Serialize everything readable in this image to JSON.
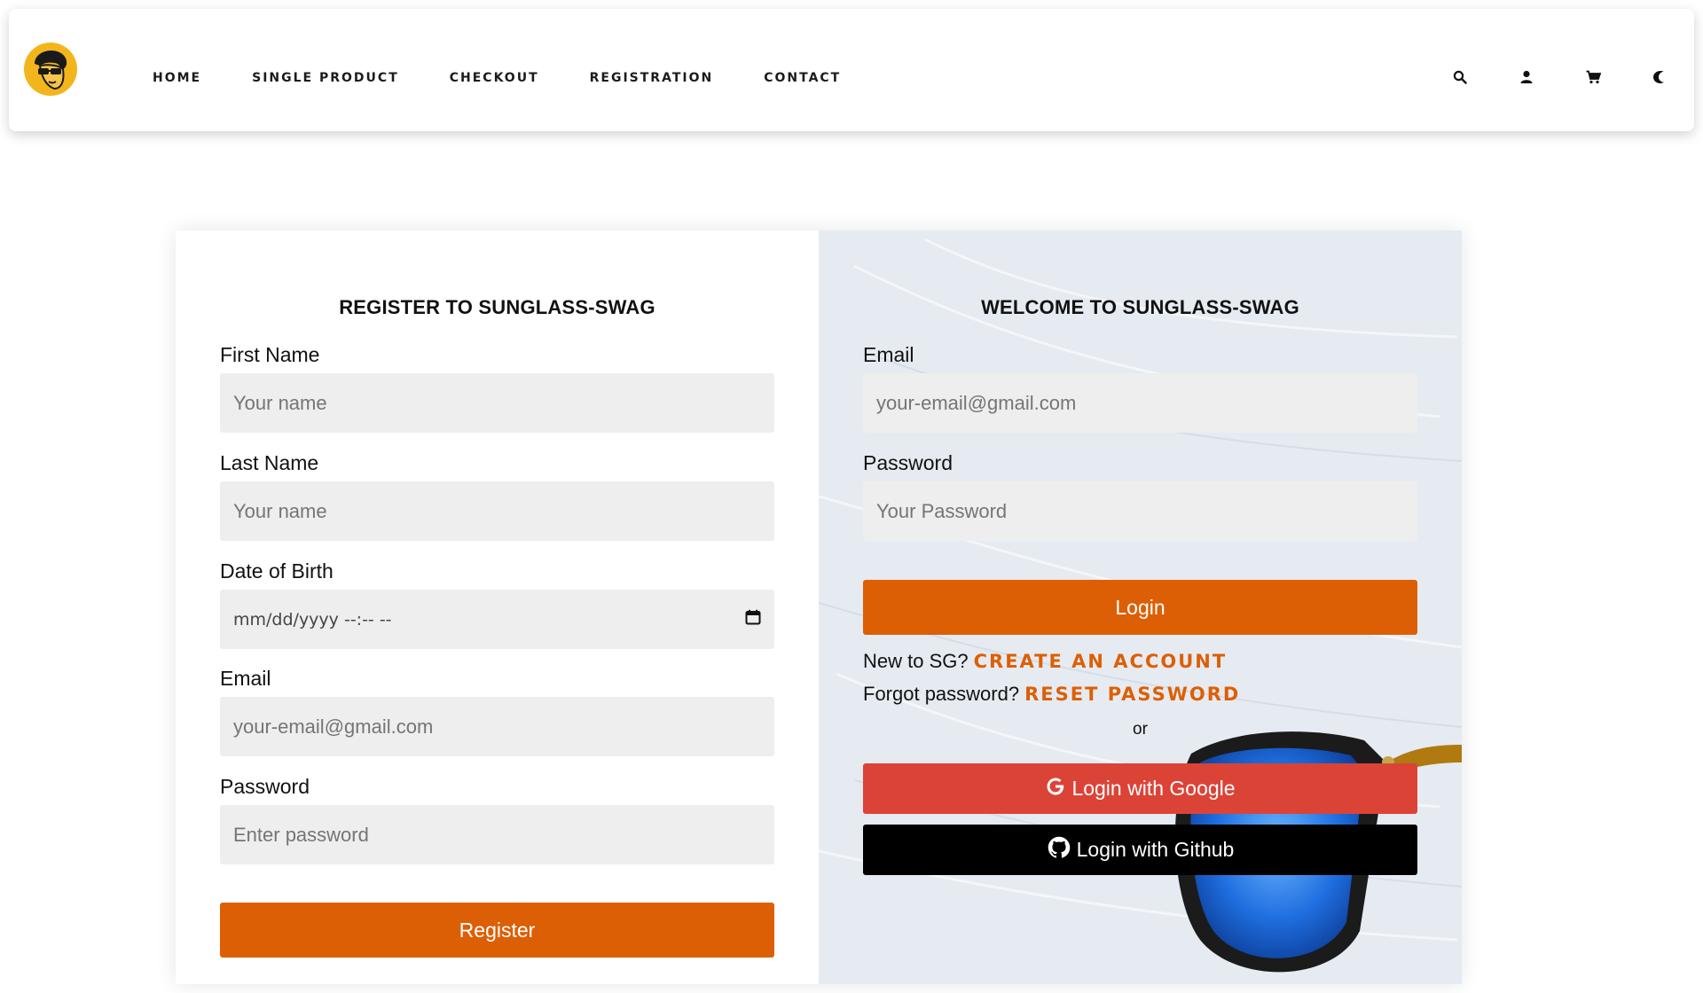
{
  "nav": {
    "links": [
      "HOME",
      "SINGLE PRODUCT",
      "CHECKOUT",
      "REGISTRATION",
      "CONTACT"
    ],
    "icons": [
      "search-icon",
      "user-icon",
      "cart-icon",
      "moon-icon"
    ]
  },
  "register": {
    "title": "REGISTER TO SUNGLASS-SWAG",
    "first_name": {
      "label": "First Name",
      "placeholder": "Your name"
    },
    "last_name": {
      "label": "Last Name",
      "placeholder": "Your name"
    },
    "dob": {
      "label": "Date of Birth",
      "placeholder": "mm/dd/yyyy --:-- --"
    },
    "email": {
      "label": "Email",
      "placeholder": "your-email@gmail.com"
    },
    "password": {
      "label": "Password",
      "placeholder": "Enter password"
    },
    "submit": "Register"
  },
  "login": {
    "title": "WELCOME TO SUNGLASS-SWAG",
    "email": {
      "label": "Email",
      "placeholder": "your-email@gmail.com"
    },
    "password": {
      "label": "Password",
      "placeholder": "Your Password"
    },
    "submit": "Login",
    "new_prompt": "New to SG?",
    "create_link": "CREATE AN ACCOUNT",
    "forgot_prompt": "Forgot password?",
    "reset_link": "RESET PASSWORD",
    "or": "or",
    "google": "Login with Google",
    "github": "Login with Github"
  },
  "colors": {
    "accent": "#dd5f05",
    "google": "#dc4337",
    "github": "#000000",
    "input_bg": "#eeeeee"
  }
}
